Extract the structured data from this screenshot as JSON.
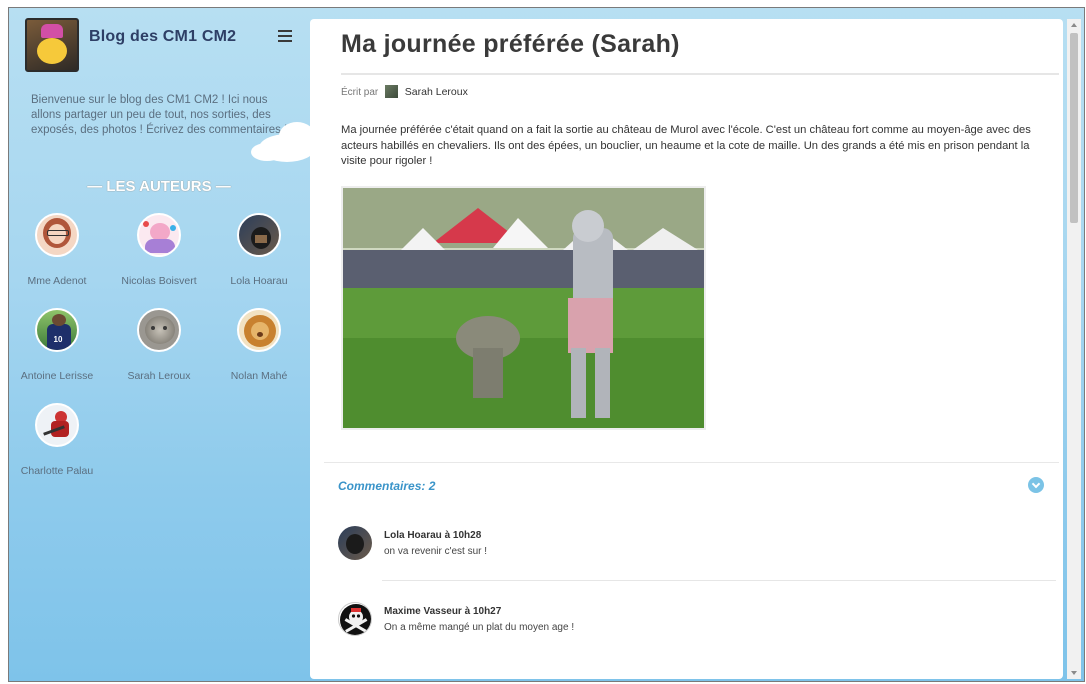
{
  "sidebar": {
    "title": "Blog des CM1 CM2",
    "intro": "Bienvenue sur le blog des CM1 CM2 ! Ici nous allons partager un peu de tout, nos sorties, des exposés, des photos ! Écrivez des commentaires !",
    "authors_heading": "— LES AUTEURS —",
    "authors": [
      {
        "name": "Mme Adenot"
      },
      {
        "name": "Nicolas Boisvert"
      },
      {
        "name": "Lola Hoarau"
      },
      {
        "name": "Antoine Lerisse"
      },
      {
        "name": "Sarah Leroux"
      },
      {
        "name": "Nolan Mahé"
      },
      {
        "name": "Charlotte Palau"
      }
    ]
  },
  "post": {
    "title": "Ma journée préférée (Sarah)",
    "written_by": "Écrit par",
    "author": "Sarah Leroux",
    "text": "Ma journée préférée c'était quand on a fait la sortie au château de Murol avec l'école. C'est un château fort comme au moyen-âge avec des acteurs habillés en chevaliers. Ils ont des épées, un bouclier, un heaume et la cote de maille. Un des grands a été mis en prison pendant la visite pour rigoler !"
  },
  "comments": {
    "title": "Commentaires: 2",
    "items": [
      {
        "header": "Lola Hoarau à 10h28",
        "text": "on va revenir c'est sur !"
      },
      {
        "header": "Maxime Vasseur à 10h27",
        "text": "On a même mangé un plat du moyen age !"
      }
    ]
  },
  "icons": {
    "menu": "hamburger-menu-icon",
    "collapse": "chevron-down-circle-icon"
  },
  "colors": {
    "sidebar_bg": "#a6d6f0",
    "accent": "#3a94c9",
    "title": "#2e3f66"
  }
}
